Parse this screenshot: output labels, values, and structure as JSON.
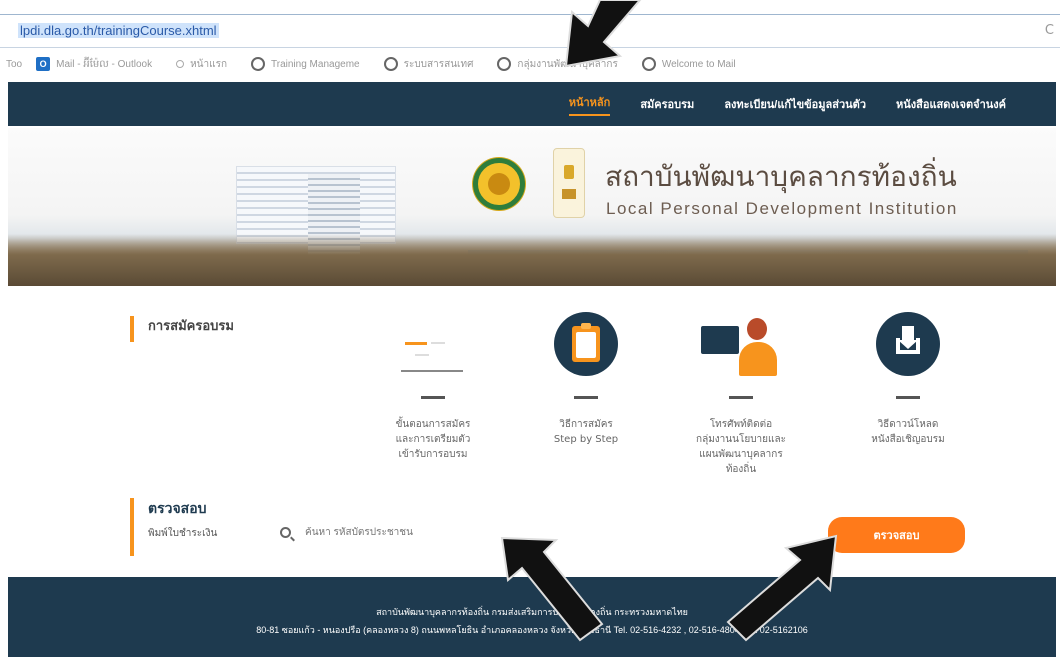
{
  "browser": {
    "url": "lpdi.dla.go.th/trainingCourse.xhtml",
    "bookmarks": [
      {
        "label": "Mail - អ៊ីម៉ែល - Outlook",
        "icon": "outlook-icon"
      },
      {
        "label": "หน้าแรก",
        "icon": "bookmark-icon"
      },
      {
        "label": "Training Manageme",
        "icon": "globe-icon"
      },
      {
        "label": "ระบบสารสนเทศ",
        "icon": "globe-icon"
      },
      {
        "label": "กลุ่มงานพัฒนาบุคลากร",
        "icon": "globe-icon"
      },
      {
        "label": "Welcome to Mail",
        "icon": "globe-icon"
      }
    ],
    "toolbar_prefix": "Too"
  },
  "nav": {
    "items": [
      {
        "label": "หน้าหลัก",
        "active": true
      },
      {
        "label": "สมัครอบรม",
        "active": false
      },
      {
        "label": "ลงทะเบียน/แก้ไขข้อมูลส่วนตัว",
        "active": false
      },
      {
        "label": "หนังสือแสดงเจตจำนงค์",
        "active": false
      }
    ]
  },
  "banner": {
    "title_th": "สถาบันพัฒนาบุคลากรท้องถิ่น",
    "title_en": "Local Personal Development Institution"
  },
  "registration": {
    "heading": "การสมัครอบรม",
    "cards": [
      {
        "text_lines": [
          "ขั้นตอนการสมัคร",
          "และการเตรียมตัว",
          "เข้ารับการอบรม"
        ],
        "icon": "document-icon"
      },
      {
        "text_lines": [
          "วิธีการสมัคร",
          "Step by Step"
        ],
        "icon": "clipboard-icon"
      },
      {
        "text_lines": [
          "โทรศัพท์ติดต่อ",
          "กลุ่มงานนโยบายและ",
          "แผนพัฒนาบุคลากร",
          "ท้องถิ่น"
        ],
        "icon": "contact-person-icon"
      },
      {
        "text_lines": [
          "วิธีดาวน์โหลด",
          "หนังสือเชิญอบรม"
        ],
        "icon": "download-icon"
      }
    ]
  },
  "check": {
    "title": "ตรวจสอบ",
    "subtitle": "พิมพ์ใบชำระเงิน",
    "search_placeholder": "ค้นหา รหัสบัตรประชาชน",
    "button_label": "ตรวจสอบ"
  },
  "footer": {
    "line1": "สถาบันพัฒนาบุคลากรท้องถิ่น กรมส่งเสริมการปกครองท้องถิ่น กระทรวงมหาดไทย",
    "line2": "80-81 ซอยแก้ว - หนองปรือ (คลองหลวง 8) ถนนพหลโยธิน อำเภอคลองหลวง จังหวัดปทุมธานี Tel. 02-516-4232 , 02-516-4804 Fax 02-5162106"
  },
  "colors": {
    "nav_bg": "#1e3a4f",
    "accent": "#f7941d",
    "button": "#ff7a1a"
  }
}
